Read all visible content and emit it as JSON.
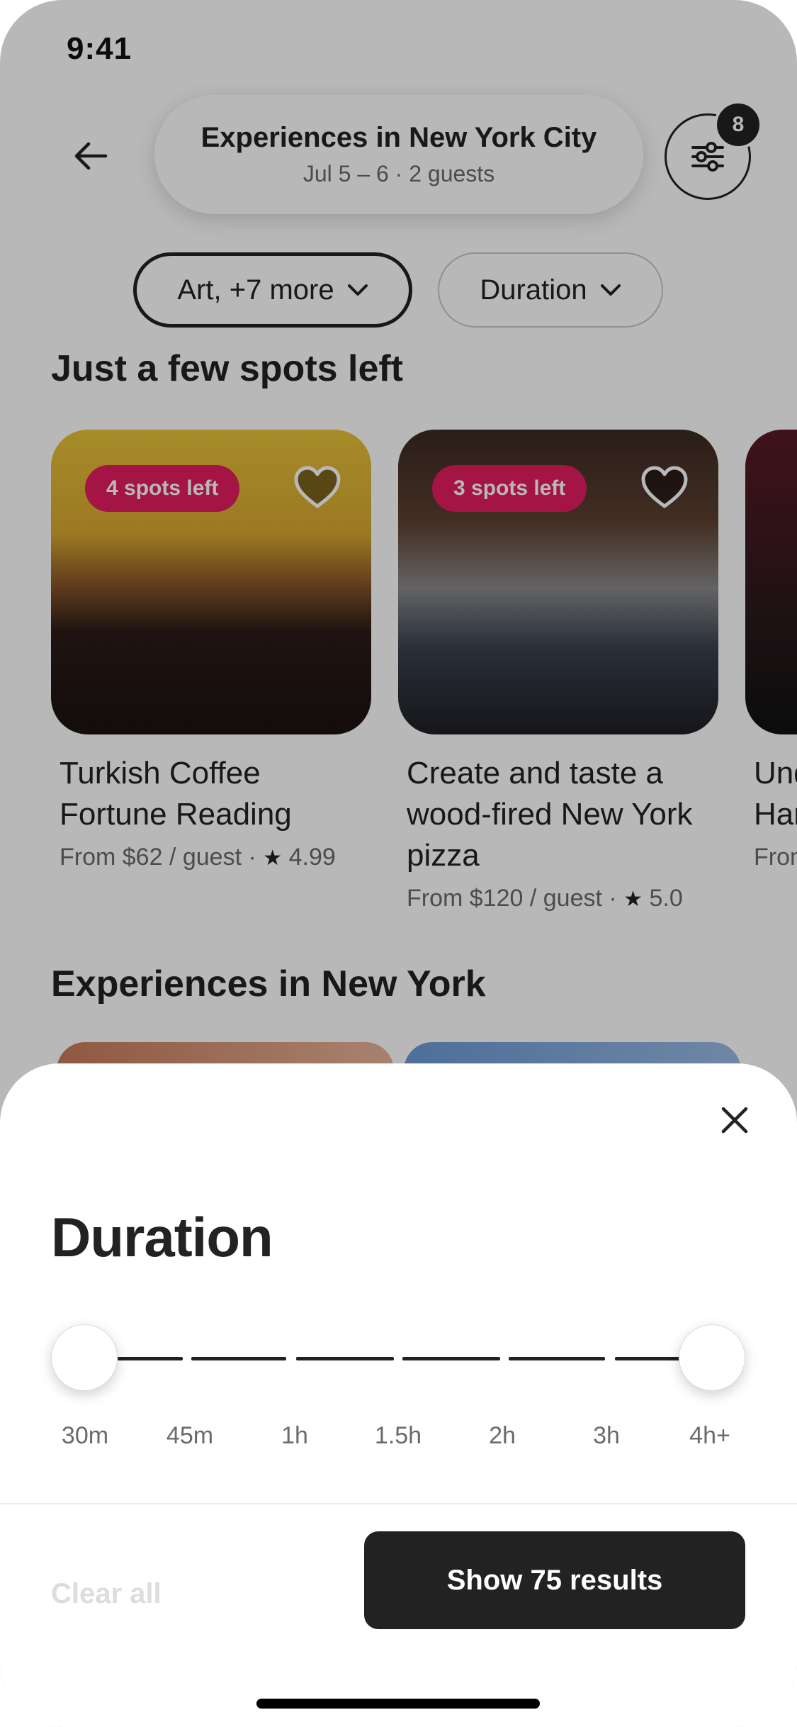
{
  "status_bar": {
    "time": "9:41"
  },
  "header": {
    "title": "Experiences in New York City",
    "subtitle": "Jul 5 – 6 · 2 guests",
    "filter_count": "8"
  },
  "chips": [
    {
      "label": "Art, +7 more"
    },
    {
      "label": "Duration"
    }
  ],
  "sections": {
    "few_spots": "Just a few spots left",
    "in_city": "Experiences in New York"
  },
  "cards": [
    {
      "badge": "4 spots left",
      "title": "Turkish Coffee Fortune Reading",
      "price": "From $62 / guest",
      "rating": "4.99"
    },
    {
      "badge": "3 spots left",
      "title": "Create and taste a wood-fired New York pizza",
      "price": "From $120 / guest",
      "rating": "5.0"
    },
    {
      "title_partial": "Und Har",
      "price_partial": "From"
    }
  ],
  "sheet": {
    "title": "Duration",
    "ticks": [
      "30m",
      "45m",
      "1h",
      "1.5h",
      "2h",
      "3h",
      "4h+"
    ],
    "selected_min": "30m",
    "selected_max": "4h+",
    "clear_label": "Clear all",
    "submit_label": "Show 75 results"
  },
  "icons": {
    "back": "arrow-left-icon",
    "filter": "sliders-icon",
    "heart": "heart-icon",
    "close": "close-icon",
    "chevron": "chevron-down-icon",
    "star": "star-icon"
  },
  "colors": {
    "badge_pink": "#e31c5f",
    "primary_dark": "#222222",
    "muted_text": "#6a6a6a"
  }
}
